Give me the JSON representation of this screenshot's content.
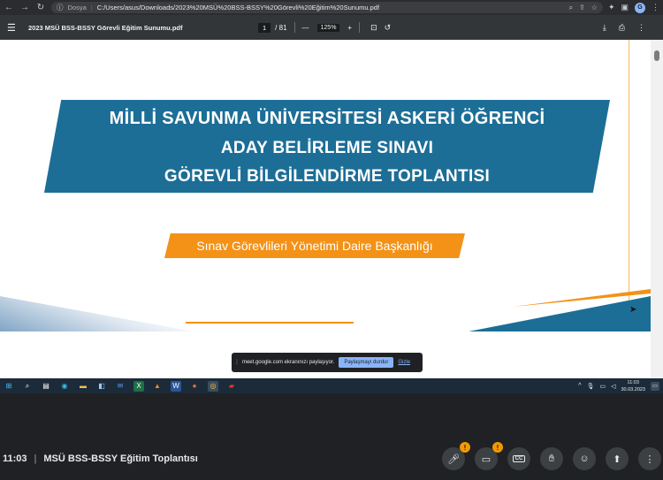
{
  "browser": {
    "file_label": "Dosya",
    "url": "C:/Users/asus/Downloads/2023%20MSÜ%20BSS-BSSY%20Görevli%20Eğitim%20Sunumu.pdf",
    "avatar_letter": "G"
  },
  "pdf_toolbar": {
    "title": "2023 MSÜ BSS-BSSY Görevli Eğitim Sunumu.pdf",
    "current_page": "1",
    "total_pages": "/ 81",
    "zoom": "125%"
  },
  "slide": {
    "line1": "MİLLİ SAVUNMA ÜNİVERSİTESİ ASKERİ ÖĞRENCİ",
    "line2": "ADAY BELİRLEME SINAVI",
    "line3": "GÖREVLİ BİLGİLENDİRME TOPLANTISI",
    "subtitle": "Sınav Görevlileri Yönetimi Daire Başkanlığı",
    "colors": {
      "banner": "#1c6e96",
      "accent": "#f39217"
    }
  },
  "share_notice": {
    "text": "meet.google.com ekranınızı paylaşıyor.",
    "stop_label": "Paylaşmayı durdur",
    "hide_label": "Gizle"
  },
  "taskbar": {
    "time": "11:03",
    "date": "30.03.2023"
  },
  "meet": {
    "time": "11:03",
    "separator": "|",
    "meeting_title": "MSÜ BSS-BSSY Eğitim Toplantısı",
    "warning_mark": "!"
  }
}
